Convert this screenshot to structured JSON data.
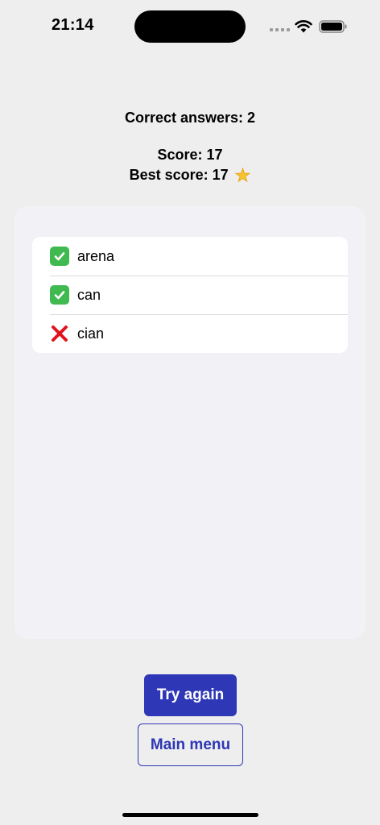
{
  "status_bar": {
    "time": "21:14"
  },
  "summary": {
    "correct_answers": "Correct answers: 2",
    "score": "Score: 17",
    "best_score": "Best score: 17",
    "best_score_icon": "star-icon"
  },
  "results": [
    {
      "word": "arena",
      "status": "correct",
      "icon": "check-icon"
    },
    {
      "word": "can",
      "status": "correct",
      "icon": "check-icon"
    },
    {
      "word": "cian",
      "status": "incorrect",
      "icon": "cross-icon"
    }
  ],
  "buttons": {
    "try_again": "Try again",
    "main_menu": "Main menu"
  },
  "colors": {
    "accent": "#2e37b5",
    "correct": "#3fb950",
    "incorrect": "#e0141e",
    "panel": "#f2f2f6",
    "background": "#eeeeee"
  }
}
